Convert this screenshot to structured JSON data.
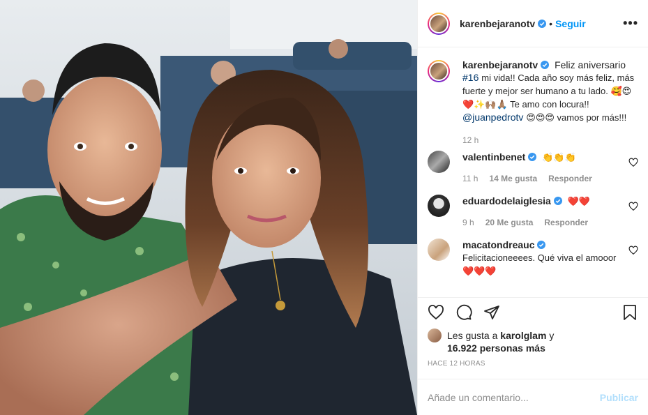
{
  "post": {
    "username": "karenbejaranotv",
    "follow_label": "Seguir",
    "more_label": "•••",
    "separator": "•"
  },
  "caption": {
    "username": "karenbejaranotv",
    "text_before_link": "Feliz aniversario",
    "hashtag": "#16",
    "text_mid": "mi vida!! Cada año soy más feliz, más fuerte y mejor ser humano a tu lado. 🥰😍❤️✨🙌🏽🙏🏽 Te amo con locura!!",
    "mention": "@juanpedrotv",
    "text_after": "😍😍😍 vamos por más!!!",
    "time": "12 h"
  },
  "comments": [
    {
      "username": "valentinbenet",
      "text": "👏👏👏",
      "time": "11 h",
      "likes": "14 Me gusta",
      "reply": "Responder"
    },
    {
      "username": "eduardodelaiglesia",
      "text": "❤️❤️",
      "time": "9 h",
      "likes": "20 Me gusta",
      "reply": "Responder"
    },
    {
      "username": "macatondreauc",
      "text": "Felicitacioneeees. Qué viva el amooor❤️❤️❤️",
      "time": "",
      "likes": "",
      "reply": ""
    }
  ],
  "likes_line": {
    "prefix": "Les gusta a",
    "user": "karolglam",
    "conj": "y",
    "count": "16.922 personas más"
  },
  "time_ago": "HACE 12 HORAS",
  "comment_input": {
    "placeholder": "Añade un comentario...",
    "publish_label": "Publicar"
  },
  "colors": {
    "link": "#0095f6",
    "verified": "#3897f0",
    "muted": "#8e8e8e",
    "publish_disabled": "#b2dffc"
  },
  "icons": {
    "like": "heart-icon",
    "comment": "comment-icon",
    "share": "paper-plane-icon",
    "save": "bookmark-icon",
    "verified": "verified-badge-icon",
    "more": "more-dots-icon"
  }
}
